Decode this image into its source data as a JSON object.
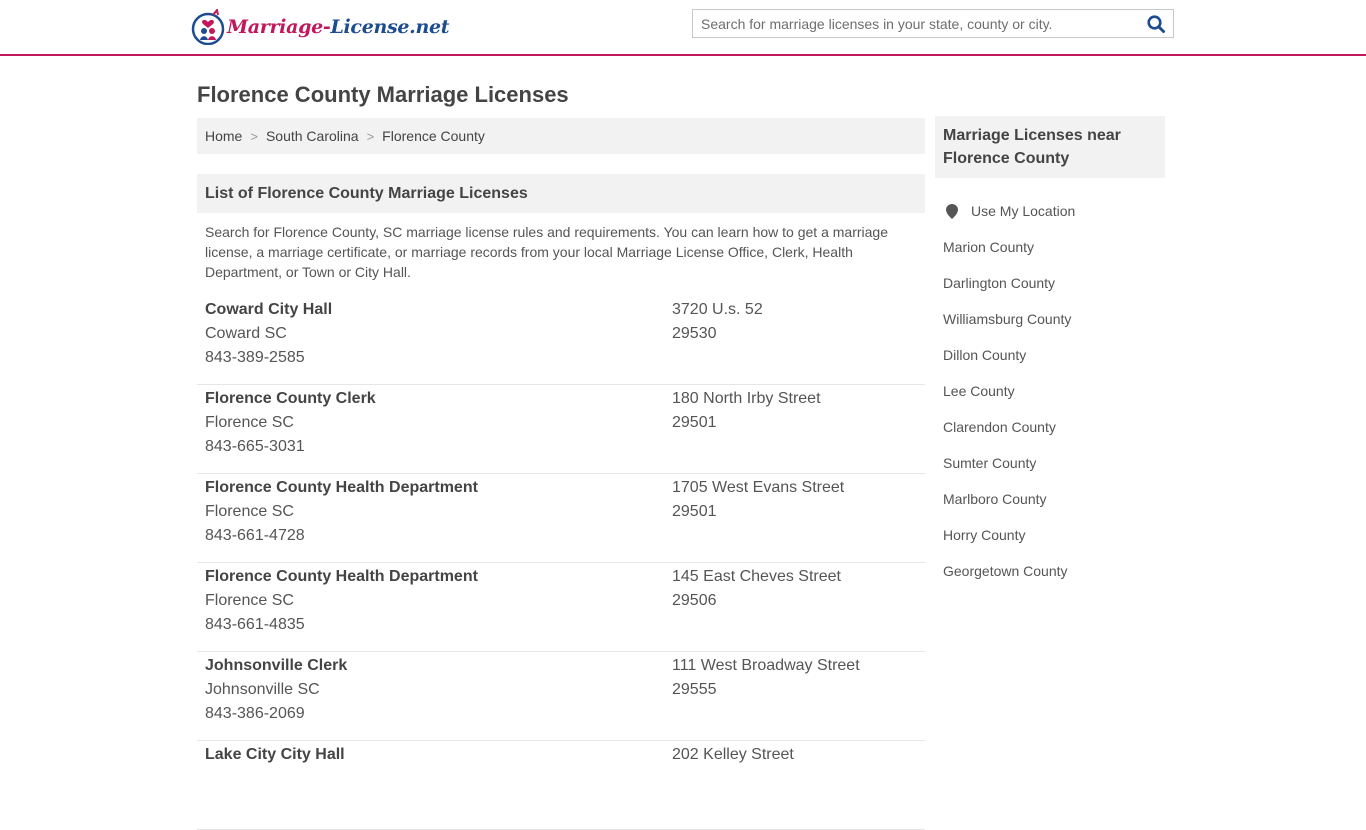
{
  "header": {
    "logo_part_a": "Marriage-",
    "logo_part_b": "License.net",
    "search_placeholder": "Search for marriage licenses in your state, county or city.",
    "search_icon": "search-icon"
  },
  "page": {
    "title": "Florence County Marriage Licenses"
  },
  "breadcrumb": {
    "items": [
      "Home",
      "South Carolina",
      "Florence County"
    ],
    "separator": ">"
  },
  "list": {
    "header": "List of Florence County Marriage Licenses",
    "intro": "Search for Florence County, SC marriage license rules and requirements. You can learn how to get a marriage license, a marriage certificate, or marriage records from your local Marriage License Office, Clerk, Health Department, or Town or City Hall.",
    "items": [
      {
        "name": "Coward City Hall",
        "city": "Coward SC",
        "phone": "843-389-2585",
        "street": "3720 U.s. 52",
        "zip": "29530"
      },
      {
        "name": "Florence County Clerk",
        "city": "Florence SC",
        "phone": "843-665-3031",
        "street": "180 North Irby Street",
        "zip": "29501"
      },
      {
        "name": "Florence County Health Department",
        "city": "Florence SC",
        "phone": "843-661-4728",
        "street": "1705 West Evans Street",
        "zip": "29501"
      },
      {
        "name": "Florence County Health Department",
        "city": "Florence SC",
        "phone": "843-661-4835",
        "street": "145 East Cheves Street",
        "zip": "29506"
      },
      {
        "name": "Johnsonville Clerk",
        "city": "Johnsonville SC",
        "phone": "843-386-2069",
        "street": "111 West Broadway Street",
        "zip": "29555"
      },
      {
        "name": "Lake City City Hall",
        "city": "",
        "phone": "",
        "street": "202 Kelley Street",
        "zip": ""
      }
    ]
  },
  "sidebar": {
    "header": "Marriage Licenses near Florence County",
    "use_location": "Use My Location",
    "location_icon": "map-pin-icon",
    "counties": [
      "Marion County",
      "Darlington County",
      "Williamsburg County",
      "Dillon County",
      "Lee County",
      "Clarendon County",
      "Sumter County",
      "Marlboro County",
      "Horry County",
      "Georgetown County"
    ]
  },
  "colors": {
    "accent": "#c2185b",
    "brand_blue": "#1e4c91",
    "panel_bg": "#f2f2f2",
    "text": "#444444"
  }
}
